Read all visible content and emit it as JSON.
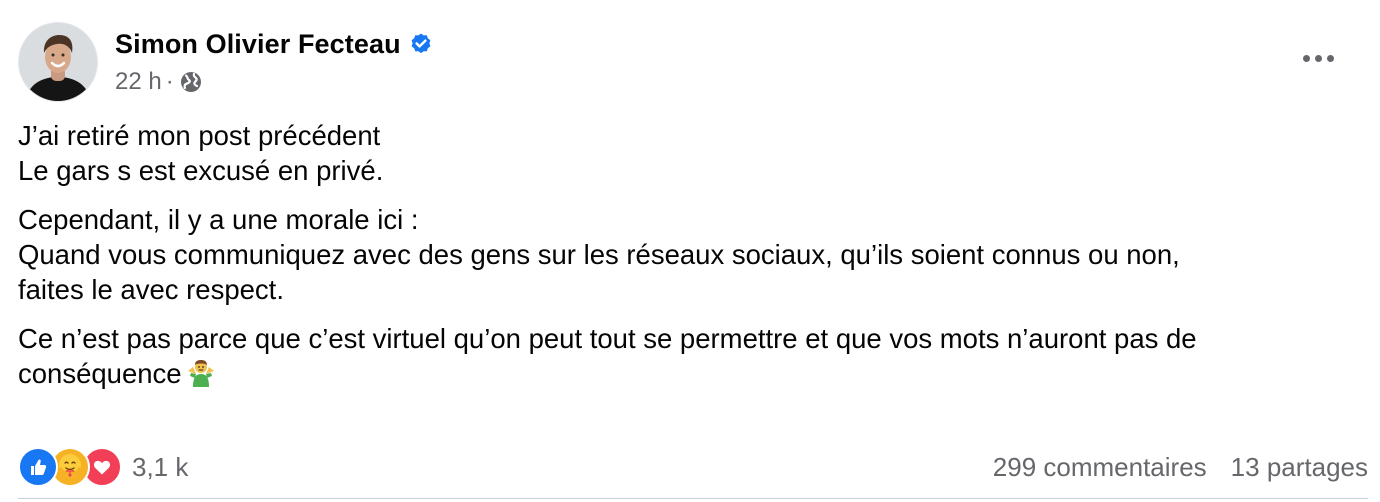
{
  "post": {
    "author": {
      "name": "Simon Olivier Fecteau",
      "verified_icon": "verified-badge-icon",
      "avatar_icon": "profile-photo"
    },
    "time": "22 h",
    "separator": "·",
    "audience_icon": "globe-icon",
    "more_icon": "more-options-icon",
    "paragraphs": [
      {
        "lines": [
          "J’ai retiré mon post précédent",
          "Le gars s est excusé en privé."
        ]
      },
      {
        "lines": [
          "Cependant, il y a une morale ici :",
          "Quand vous communiquez avec des gens sur les réseaux sociaux, qu’ils soient connus ou non,",
          "faites le avec respect."
        ]
      },
      {
        "lines": [
          "Ce n’est pas parce que c’est virtuel qu’on peut tout se permettre et que vos mots n’auront pas de",
          "conséquence"
        ]
      }
    ],
    "trailing_emoji": "man-shrugging-emoji",
    "reactions": {
      "icons": [
        "like-icon",
        "care-icon",
        "love-icon"
      ],
      "count": "3,1 k"
    },
    "comments": "299 commentaires",
    "shares": "13 partages"
  },
  "colors": {
    "text_primary": "#050505",
    "text_secondary": "#65676b",
    "facebook_blue": "#1877f2",
    "care_yellow": "#f7b125",
    "love_red": "#f33e58",
    "divider": "#ced0d4"
  }
}
